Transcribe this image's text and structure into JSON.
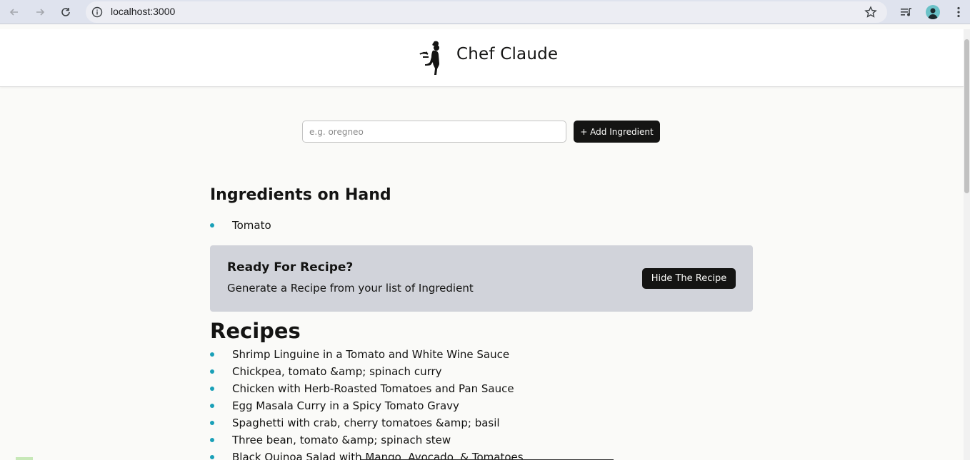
{
  "browser": {
    "url": "localhost:3000"
  },
  "header": {
    "brand": "Chef Claude"
  },
  "form": {
    "placeholder": "e.g. oregneo",
    "add_button": "+ Add Ingredient"
  },
  "ingredients": {
    "title": "Ingredients on Hand",
    "items": [
      "Tomato"
    ]
  },
  "recipe_card": {
    "title": "Ready For Recipe?",
    "subtitle": "Generate a Recipe from your list of Ingredient",
    "button": "Hide The Recipe"
  },
  "recipes": {
    "title": "Recipes",
    "items": [
      "Shrimp Linguine in a Tomato and White Wine Sauce",
      "Chickpea, tomato &amp; spinach curry",
      "Chicken with Herb-Roasted Tomatoes and Pan Sauce",
      "Egg Masala Curry in a Spicy Tomato Gravy",
      "Spaghetti with crab, cherry tomatoes &amp; basil",
      "Three bean, tomato &amp; spinach stew",
      "Black Quinoa Salad with Mango, Avocado, & Tomatoes"
    ]
  },
  "colors": {
    "accent_bullet": "#1aa0b8",
    "button_bg": "#141413",
    "card_bg": "#d1d3da"
  }
}
